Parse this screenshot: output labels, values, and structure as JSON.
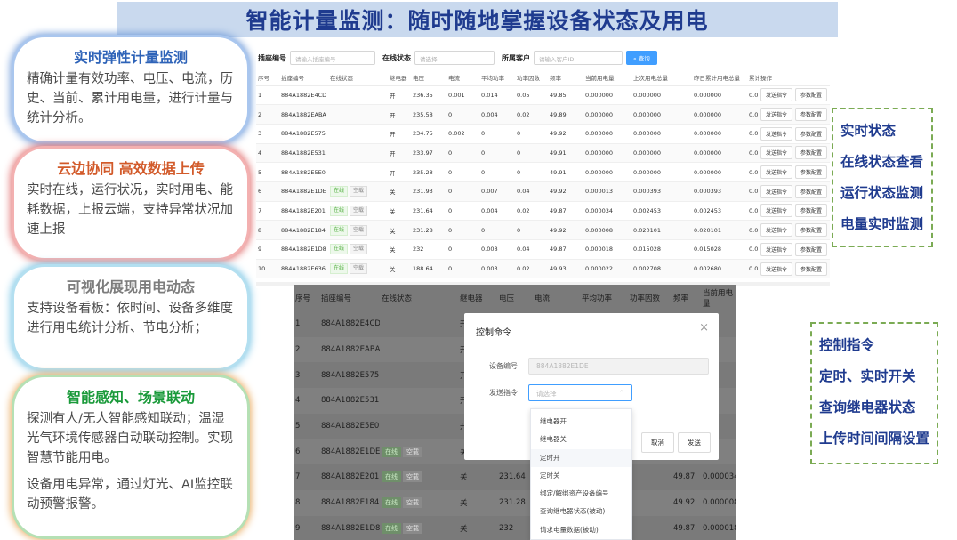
{
  "title": "智能计量监测：随时随地掌握设备状态及用电",
  "cards": [
    {
      "title": "实时弹性计量监测",
      "body": [
        "精确计量有效功率、电压、电流，历史、当前、累计用电量，进行计量与统计分析。"
      ]
    },
    {
      "title": "云边协同 高效数据上传",
      "body": [
        "实时在线，运行状况，实时用电、能耗数据，上报云端，支持异常状况加速上报"
      ]
    },
    {
      "title": "可视化展现用电动态",
      "body": [
        "支持设备看板：依时间、设备多维度进行用电统计分析、节电分析；"
      ]
    },
    {
      "title": "智能感知、场景联动",
      "body": [
        "探测有人/无人智能感知联动；温湿光气环境传感器自动联动控制。实现智慧节能用电。",
        "设备用电异常，通过灯光、AI监控联动预警报警。"
      ]
    }
  ],
  "filter": {
    "socket_label": "插座编号",
    "socket_placeholder": "请输入插座编号",
    "status_label": "在线状态",
    "status_placeholder": "请选择",
    "customer_label": "所属客户",
    "customer_placeholder": "请输入客户ID",
    "query_button": "查询"
  },
  "table1": {
    "headers": [
      "序号",
      "插座编号",
      "在线状态",
      "继电器",
      "电压",
      "电流",
      "平均功率",
      "功率因数",
      "频率",
      "当前用电量",
      "上次用电总量",
      "昨日累计用电总量",
      "累计",
      "操作"
    ],
    "online": "在线",
    "idle": "空载",
    "send_cmd": "发送指令",
    "param_cfg": "参数配置",
    "rows": [
      {
        "no": "1",
        "id": "884A1882E4CD",
        "tags": false,
        "relay": "开",
        "v": "236.35",
        "a": "0.001",
        "p": "0.014",
        "pf": "0.05",
        "hz": "49.85",
        "cur": "0.000000",
        "last": "0.000000",
        "yest": "0.000000",
        "acc": "0.0"
      },
      {
        "no": "2",
        "id": "884A1882EABA",
        "tags": false,
        "relay": "开",
        "v": "235.58",
        "a": "0",
        "p": "0.004",
        "pf": "0.02",
        "hz": "49.89",
        "cur": "0.000000",
        "last": "0.000000",
        "yest": "0.000000",
        "acc": "0.0"
      },
      {
        "no": "3",
        "id": "884A1882E575",
        "tags": false,
        "relay": "开",
        "v": "234.75",
        "a": "0.002",
        "p": "0",
        "pf": "0",
        "hz": "49.92",
        "cur": "0.000000",
        "last": "0.000000",
        "yest": "0.000000",
        "acc": "0.0"
      },
      {
        "no": "4",
        "id": "884A1882E531",
        "tags": false,
        "relay": "开",
        "v": "233.97",
        "a": "0",
        "p": "0",
        "pf": "0",
        "hz": "49.91",
        "cur": "0.000000",
        "last": "0.000000",
        "yest": "0.000000",
        "acc": "0.0"
      },
      {
        "no": "5",
        "id": "884A1882E5E0",
        "tags": false,
        "relay": "开",
        "v": "235.28",
        "a": "0",
        "p": "0",
        "pf": "0",
        "hz": "49.91",
        "cur": "0.000000",
        "last": "0.000000",
        "yest": "0.000000",
        "acc": "0.0"
      },
      {
        "no": "6",
        "id": "884A1882E1DE",
        "tags": true,
        "relay": "关",
        "v": "231.93",
        "a": "0",
        "p": "0.007",
        "pf": "0.04",
        "hz": "49.92",
        "cur": "0.000013",
        "last": "0.000393",
        "yest": "0.000393",
        "acc": "0.0"
      },
      {
        "no": "7",
        "id": "884A1882E201",
        "tags": true,
        "relay": "关",
        "v": "231.64",
        "a": "0",
        "p": "0.004",
        "pf": "0.02",
        "hz": "49.87",
        "cur": "0.000034",
        "last": "0.002453",
        "yest": "0.002453",
        "acc": "0.0"
      },
      {
        "no": "8",
        "id": "884A1882E184",
        "tags": true,
        "relay": "关",
        "v": "231.28",
        "a": "0",
        "p": "0",
        "pf": "0",
        "hz": "49.92",
        "cur": "0.000008",
        "last": "0.020101",
        "yest": "0.020101",
        "acc": "0.0"
      },
      {
        "no": "9",
        "id": "884A1882E1D8",
        "tags": true,
        "relay": "关",
        "v": "232",
        "a": "0",
        "p": "0.008",
        "pf": "0.04",
        "hz": "49.87",
        "cur": "0.000018",
        "last": "0.015028",
        "yest": "0.015028",
        "acc": "0.0"
      },
      {
        "no": "10",
        "id": "884A1882E636",
        "tags": true,
        "relay": "关",
        "v": "188.64",
        "a": "0",
        "p": "0.003",
        "pf": "0.02",
        "hz": "49.93",
        "cur": "0.000022",
        "last": "0.002708",
        "yest": "0.002680",
        "acc": "0.0"
      }
    ]
  },
  "table2": {
    "headers": [
      "序号",
      "插座编号",
      "在线状态",
      "继电器",
      "电压",
      "电流",
      "平均功率",
      "功率因数",
      "频率",
      "当前用电量"
    ],
    "rows": [
      {
        "no": "1",
        "id": "884A1882E4CD",
        "tags": false,
        "relay": "开",
        "v": "",
        "hz": "",
        "cur": ""
      },
      {
        "no": "2",
        "id": "884A1882EABA",
        "tags": false,
        "relay": "开",
        "v": "",
        "hz": "",
        "cur": ""
      },
      {
        "no": "3",
        "id": "884A1882E575",
        "tags": false,
        "relay": "开",
        "v": "",
        "hz": "",
        "cur": ""
      },
      {
        "no": "4",
        "id": "884A1882E531",
        "tags": false,
        "relay": "开",
        "v": "",
        "hz": "",
        "cur": ""
      },
      {
        "no": "5",
        "id": "884A1882E5E0",
        "tags": false,
        "relay": "开",
        "v": "",
        "hz": "",
        "cur": ""
      },
      {
        "no": "6",
        "id": "884A1882E1DE",
        "tags": true,
        "relay": "关",
        "v": "",
        "hz": "",
        "cur": ""
      },
      {
        "no": "7",
        "id": "884A1882E201",
        "tags": true,
        "relay": "关",
        "v": "231.64",
        "hz": "49.87",
        "cur": "0.000034"
      },
      {
        "no": "8",
        "id": "884A1882E184",
        "tags": true,
        "relay": "关",
        "v": "231.28",
        "hz": "49.92",
        "cur": "0.000008"
      },
      {
        "no": "9",
        "id": "884A1882E1D8",
        "tags": true,
        "relay": "关",
        "v": "232",
        "hz": "49.87",
        "cur": "0.000018"
      },
      {
        "no": "10",
        "id": "884A1882E636",
        "tags": true,
        "relay": "关",
        "v": "188.64",
        "hz": "49.93",
        "cur": "0.000022"
      }
    ]
  },
  "modal": {
    "title": "控制命令",
    "device_label": "设备编号",
    "device_value": "884A1882E1DE",
    "cmd_label": "发送指令",
    "cmd_placeholder": "请选择",
    "cancel": "取消",
    "send": "发送"
  },
  "dropdown": [
    "继电器开",
    "继电器关",
    "定时开",
    "定时关",
    "绑定/解绑资产设备编号",
    "查询继电器状态(被动)",
    "请求电量数据(被动)"
  ],
  "right_box1": [
    "实时状态",
    "在线状态查看",
    "运行状态监测",
    "电量实时监测"
  ],
  "right_box2": [
    "控制指令",
    "定时、实时开关",
    "查询继电器状态",
    "上传时间间隔设置"
  ]
}
